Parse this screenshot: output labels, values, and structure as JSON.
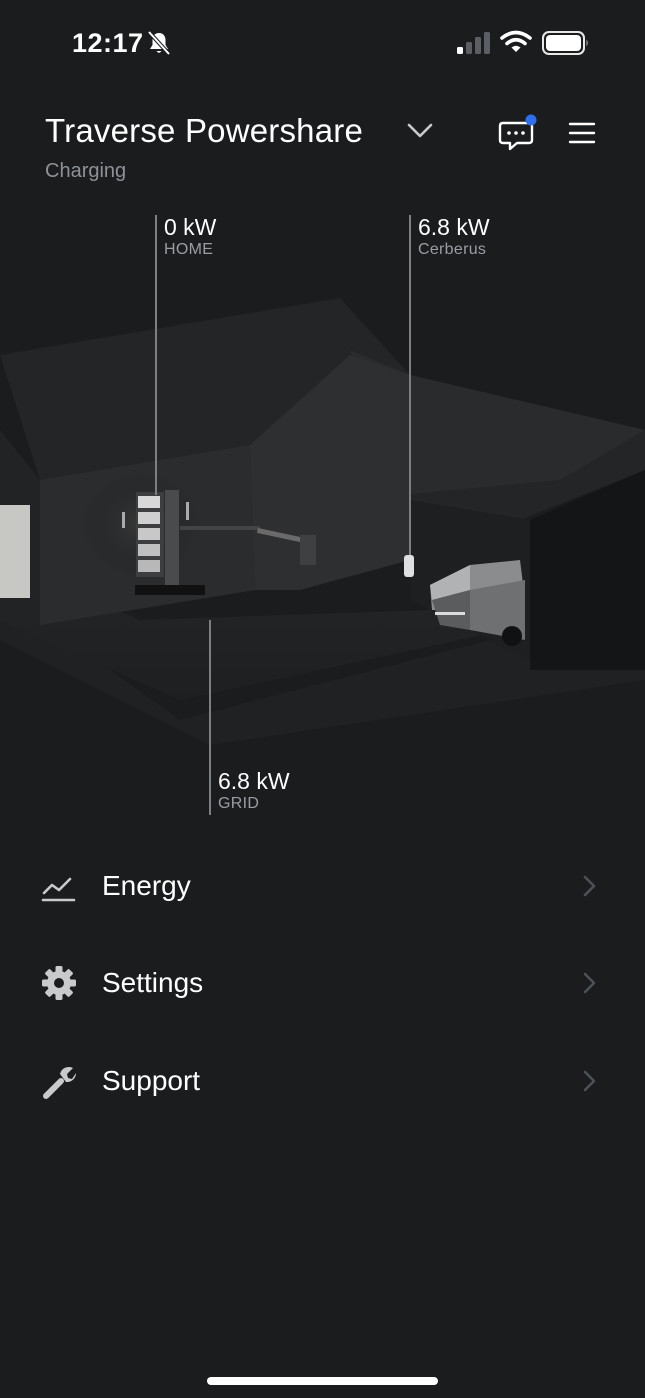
{
  "status_bar": {
    "time": "12:17",
    "icons": [
      "bell-off-icon",
      "signal-icon",
      "wifi-icon",
      "battery-icon"
    ]
  },
  "header": {
    "title": "Traverse Powershare",
    "status": "Charging",
    "icons": [
      "chevron-down-icon",
      "chat-icon",
      "menu-icon"
    ],
    "notification_dot_color": "#2f6fed"
  },
  "flows": {
    "home": {
      "value": "0 kW",
      "label": "HOME"
    },
    "vehicle": {
      "value": "6.8 kW",
      "label": "Cerberus"
    },
    "grid": {
      "value": "6.8 kW",
      "label": "GRID"
    }
  },
  "nav": [
    {
      "label": "Energy",
      "icon": "energy-chart-icon"
    },
    {
      "label": "Settings",
      "icon": "gear-icon"
    },
    {
      "label": "Support",
      "icon": "wrench-icon"
    }
  ],
  "colors": {
    "background": "#1a1c1e",
    "text_primary": "#ffffff",
    "text_secondary": "#8e9296",
    "accent_dot": "#2f6fed"
  }
}
